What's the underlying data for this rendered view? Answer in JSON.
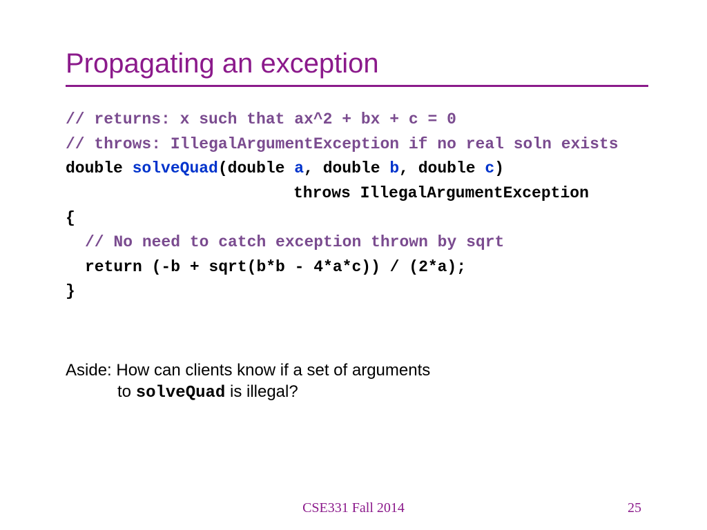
{
  "title": "Propagating an exception",
  "code": {
    "line1": "// returns: x such that ax^2 + bx + c = 0",
    "line2": "// throws: IllegalArgumentException if no real soln exists",
    "line3_double": "double ",
    "line3_method": "solveQuad",
    "line3_open": "(double ",
    "line3_a": "a",
    "line3_c1": ", double ",
    "line3_b": "b",
    "line3_c2": ", double ",
    "line3_c": "c",
    "line3_close": ") ",
    "line4": "throws IllegalArgumentException",
    "line5": "{",
    "line6": "// No need to catch exception thrown by sqrt",
    "line7": "return (-b + sqrt(b*b - 4*a*c)) / (2*a);",
    "line8": "}"
  },
  "aside": {
    "line1": "Aside: How can clients know if a set of arguments",
    "line2_pre": "to ",
    "line2_mono": "solveQuad",
    "line2_post": " is illegal?"
  },
  "footer": "CSE331 Fall 2014",
  "pagenum": "25"
}
